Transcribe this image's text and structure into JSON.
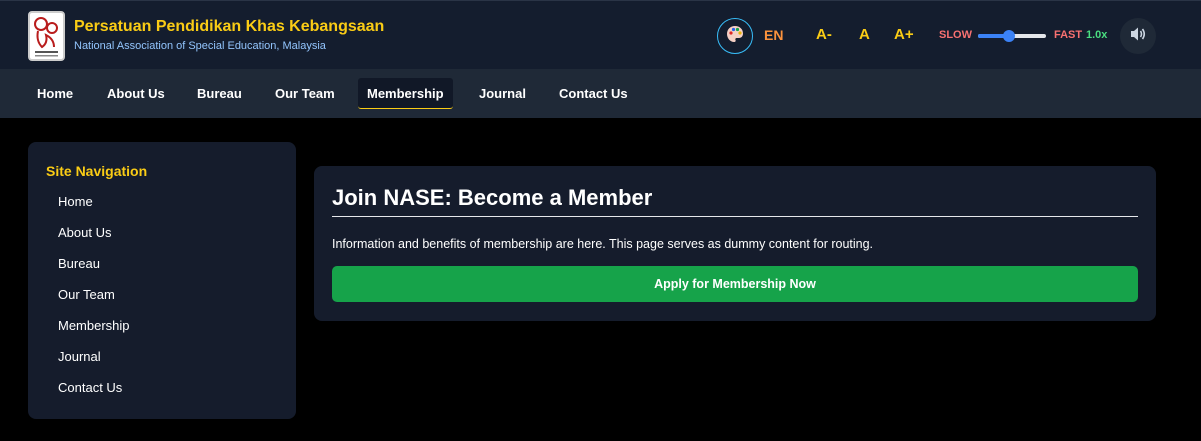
{
  "header": {
    "title": "Persatuan Pendidikan Khas Kebangsaan",
    "subtitle": "National Association of Special Education, Malaysia",
    "logo_icon": "organization-logo-icon"
  },
  "toolbar": {
    "theme_icon": "palette-icon",
    "language": "EN",
    "font_decrease": "A-",
    "font_normal": "A",
    "font_increase": "A+",
    "speed_slow_label": "SLOW",
    "speed_fast_label": "FAST",
    "speed_value": "1.0x",
    "speed_fraction": 0.45,
    "sound_icon": "speaker-icon"
  },
  "nav": {
    "items": [
      {
        "label": "Home"
      },
      {
        "label": "About Us"
      },
      {
        "label": "Bureau"
      },
      {
        "label": "Our Team"
      },
      {
        "label": "Membership",
        "active": true
      },
      {
        "label": "Journal"
      },
      {
        "label": "Contact Us"
      }
    ]
  },
  "sidebar": {
    "title": "Site Navigation",
    "items": [
      {
        "label": "Home"
      },
      {
        "label": "About Us"
      },
      {
        "label": "Bureau"
      },
      {
        "label": "Our Team"
      },
      {
        "label": "Membership"
      },
      {
        "label": "Journal"
      },
      {
        "label": "Contact Us"
      }
    ]
  },
  "main": {
    "title": "Join NASE: Become a Member",
    "body": "Information and benefits of membership are here. This page serves as dummy content for routing.",
    "cta_label": "Apply for Membership Now"
  },
  "colors": {
    "accent_yellow": "#facc15",
    "cta_green": "#16a34a",
    "header_bg": "#141d2e",
    "nav_bg": "#1f2937",
    "card_bg": "#151c2c"
  }
}
